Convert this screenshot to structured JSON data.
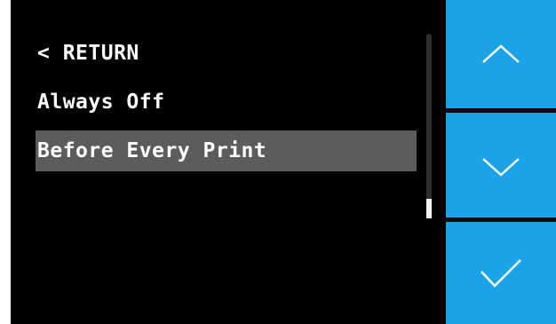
{
  "menu": {
    "items": [
      {
        "label": "< RETURN"
      },
      {
        "label": "Always Off"
      },
      {
        "label": "Before Every Print"
      }
    ],
    "selected_label": "Before Every Print",
    "scroll_position": 1.0
  },
  "buttons": {
    "up": {
      "icon": "chevron-up-icon"
    },
    "down": {
      "icon": "chevron-down-icon"
    },
    "confirm": {
      "icon": "checkmark-icon"
    }
  },
  "colors": {
    "background": "#000000",
    "accent": "#1aa3e8",
    "selection": "#5c5c5c",
    "text": "#ffffff"
  }
}
